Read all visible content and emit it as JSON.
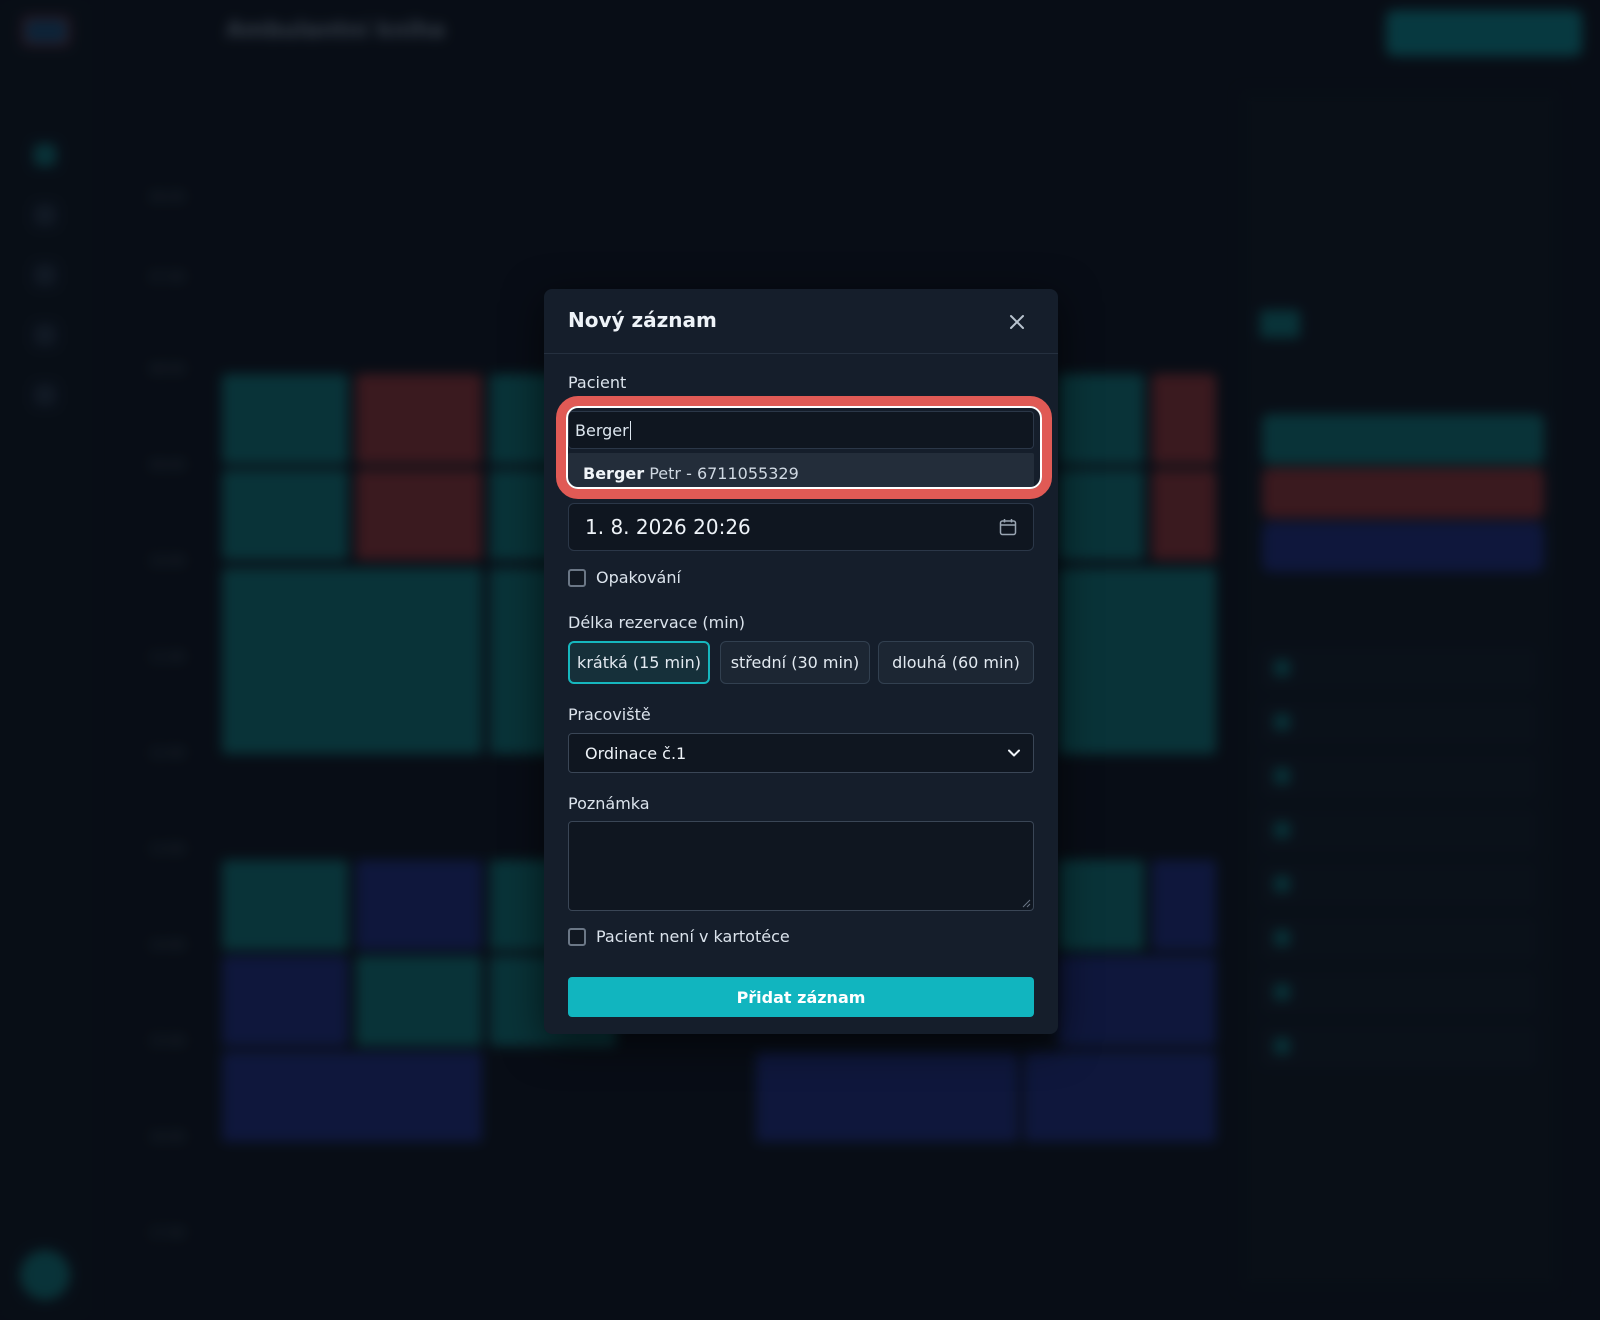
{
  "background": {
    "app_title": "Ambulantní kniha",
    "hours": [
      "06:00",
      "07:00",
      "08:00",
      "09:00",
      "10:00",
      "11:00",
      "12:00",
      "13:00",
      "14:00",
      "15:00",
      "16:00",
      "17:00"
    ]
  },
  "modal": {
    "title": "Nový záznam",
    "patient_label": "Pacient",
    "patient_value": "Berger",
    "suggestion": {
      "match": "Berger",
      "rest": " Petr - 6711055329"
    },
    "datetime_value": "1. 8. 2026 20:26",
    "repeat_label": "Opakování",
    "duration_label": "Délka rezervace (min)",
    "duration_options": [
      "krátká (15 min)",
      "střední (30 min)",
      "dlouhá (60 min)"
    ],
    "duration_selected": "krátká (15 min)",
    "workplace_label": "Pracoviště",
    "workplace_value": "Ordinace č.1",
    "note_label": "Poznámka",
    "not_in_registry_label": "Pacient není v kartotéce",
    "submit_label": "Přidat záznam"
  },
  "colors": {
    "accent": "#11b5bf",
    "highlight": "#e05a55",
    "event_teal": "#108f8e",
    "event_red": "#b23a3a",
    "event_blue": "#22339a"
  }
}
